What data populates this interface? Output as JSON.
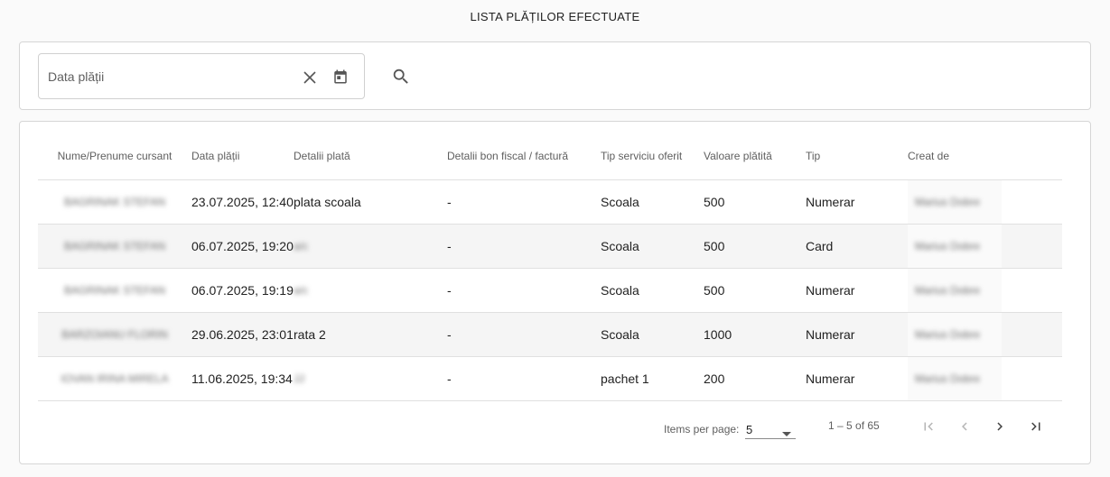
{
  "page": {
    "title": "LISTA PLĂȚILOR EFECTUATE"
  },
  "filter": {
    "date_placeholder": "Data plății",
    "icons": {
      "clear": "close-icon",
      "calendar": "calendar-icon",
      "search": "search-icon"
    }
  },
  "table": {
    "columns": [
      "Nume/Prenume cursant",
      "Data plății",
      "Detalii plată",
      "Detalii bon fiscal / factură",
      "Tip serviciu oferit",
      "Valoare plătită",
      "Tip",
      "Creat de"
    ],
    "rows": [
      {
        "name": "BAGRINAK STEFAN",
        "date": "23.07.2025, 12:40",
        "details": "plata scoala",
        "details_blurred": false,
        "receipt": "-",
        "service": "Scoala",
        "amount": "500",
        "type": "Numerar",
        "creator": "Marius Dobre"
      },
      {
        "name": "BAGRINAK STEFAN",
        "date": "06.07.2025, 19:20",
        "details": "a/c",
        "details_blurred": true,
        "receipt": "-",
        "service": "Scoala",
        "amount": "500",
        "type": "Card",
        "creator": "Marius Dobre"
      },
      {
        "name": "BAGRINAK STEFAN",
        "date": "06.07.2025, 19:19",
        "details": "a/c",
        "details_blurred": true,
        "receipt": "-",
        "service": "Scoala",
        "amount": "500",
        "type": "Numerar",
        "creator": "Marius Dobre"
      },
      {
        "name": "BARZOIANU FLORIN",
        "date": "29.06.2025, 23:01",
        "details": "rata 2",
        "details_blurred": false,
        "receipt": "-",
        "service": "Scoala",
        "amount": "1000",
        "type": "Numerar",
        "creator": "Marius Dobre"
      },
      {
        "name": "IOVAN IRINA MIRELA",
        "date": "11.06.2025, 19:34",
        "details": "JJ",
        "details_blurred": true,
        "receipt": "-",
        "service": "pachet 1",
        "amount": "200",
        "type": "Numerar",
        "creator": "Marius Dobre"
      }
    ]
  },
  "paginator": {
    "items_per_page_label": "Items per page:",
    "page_size": "5",
    "range_label": "1 – 5 of 65",
    "icons": {
      "first": "first-page-icon",
      "prev": "chevron-left-icon",
      "next": "chevron-right-icon",
      "last": "last-page-icon"
    }
  }
}
